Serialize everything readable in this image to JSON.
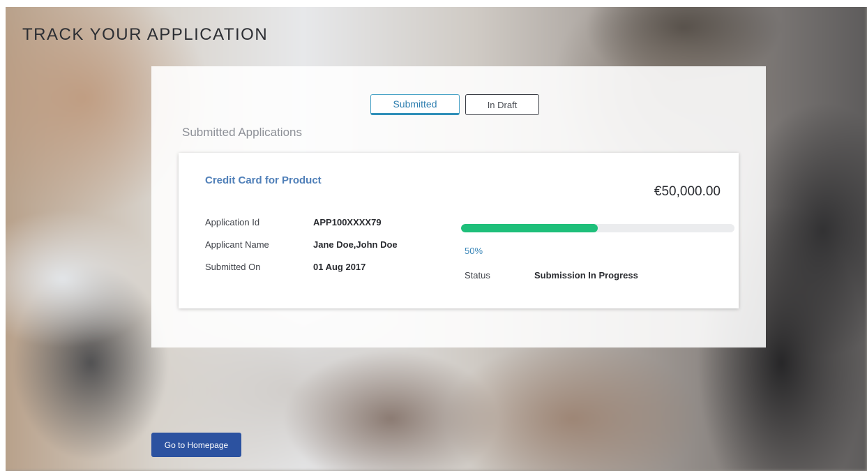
{
  "page": {
    "title": "TRACK YOUR APPLICATION"
  },
  "tabs": [
    {
      "label": "Submitted",
      "active": true
    },
    {
      "label": "In Draft",
      "active": false
    }
  ],
  "section": {
    "title": "Submitted Applications"
  },
  "application": {
    "product": "Credit Card for Product",
    "amount": "€50,000.00",
    "fields": [
      {
        "label": "Application Id",
        "value": "APP100XXXX79"
      },
      {
        "label": "Applicant Name",
        "value": "Jane Doe,John Doe"
      },
      {
        "label": "Submitted On",
        "value": "01 Aug 2017"
      }
    ],
    "progress": {
      "percent": 50,
      "label": "50%"
    },
    "status": {
      "label": "Status",
      "value": "Submission In Progress"
    }
  },
  "footer": {
    "home_button_label": "Go to Homepage"
  },
  "colors": {
    "accent": "#2f8fb9",
    "progress": "#1ebf7a",
    "button": "#2c52a0",
    "product_link": "#4f7fb8"
  }
}
